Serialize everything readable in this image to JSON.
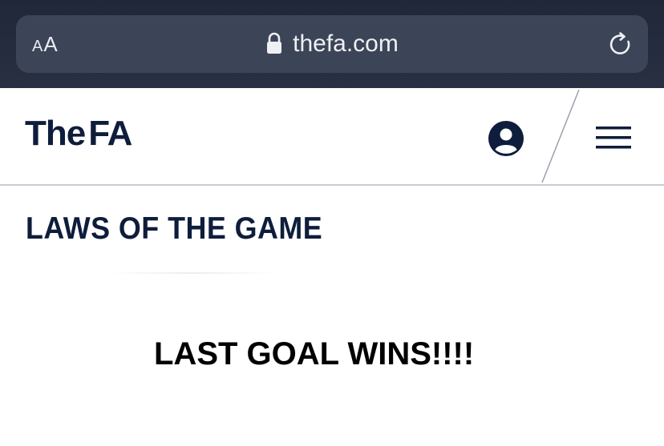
{
  "browser": {
    "reader_small": "A",
    "reader_big": "A",
    "url": "thefa.com",
    "icons": {
      "lock": "lock-icon",
      "reload": "reload-icon"
    },
    "colors": {
      "chrome_bg": "#242b3d",
      "address_bar_bg": "#3c4457",
      "text": "#eef0f3"
    }
  },
  "site_header": {
    "logo_the": "The",
    "logo_fa": "FA",
    "icons": {
      "account": "user-account-icon",
      "menu": "hamburger-menu-icon"
    },
    "colors": {
      "brand_navy": "#0e1d3b"
    }
  },
  "main": {
    "title": "LAWS OF THE GAME",
    "body_text": "LAST GOAL WINS!!!!"
  }
}
